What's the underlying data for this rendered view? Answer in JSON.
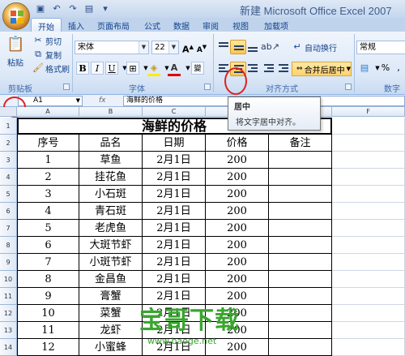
{
  "window": {
    "title": "新建 Microsoft Office Excel 2007"
  },
  "tabs": [
    "开始",
    "插入",
    "页面布局",
    "公式",
    "数据",
    "审阅",
    "视图",
    "加载项"
  ],
  "ribbon": {
    "clipboard": {
      "paste": "粘贴",
      "cut": "剪切",
      "copy": "复制",
      "format_painter": "格式刷",
      "label": "剪贴板"
    },
    "font": {
      "name": "宋体",
      "size": "22",
      "label": "字体",
      "bold": "B",
      "italic": "I",
      "underline": "U"
    },
    "alignment": {
      "wrap_text": "自动换行",
      "merge_center": "合并后居中",
      "label": "对齐方式"
    },
    "number": {
      "format": "常规",
      "percent": "%",
      "label": "数字"
    }
  },
  "formula_bar": {
    "name_box": "A1",
    "fx": "fx",
    "content": "海鲜的价格"
  },
  "tooltip": {
    "title": "居中",
    "body": "将文字居中对齐。"
  },
  "columns": [
    "A",
    "B",
    "C",
    "D",
    "E",
    "F"
  ],
  "sheet": {
    "title": "海鲜的价格",
    "headers": [
      "序号",
      "品名",
      "日期",
      "价格",
      "备注"
    ],
    "rows": [
      [
        "1",
        "草鱼",
        "2月1日",
        "200",
        ""
      ],
      [
        "2",
        "挂花鱼",
        "2月1日",
        "200",
        ""
      ],
      [
        "3",
        "小石斑",
        "2月1日",
        "200",
        ""
      ],
      [
        "4",
        "青石斑",
        "2月1日",
        "200",
        ""
      ],
      [
        "5",
        "老虎鱼",
        "2月1日",
        "200",
        ""
      ],
      [
        "6",
        "大斑节虾",
        "2月1日",
        "200",
        ""
      ],
      [
        "7",
        "小斑节虾",
        "2月1日",
        "200",
        ""
      ],
      [
        "8",
        "金昌鱼",
        "2月1日",
        "200",
        ""
      ],
      [
        "9",
        "膏蟹",
        "2月1日",
        "200",
        ""
      ],
      [
        "10",
        "菜蟹",
        "2月1日",
        "200",
        ""
      ],
      [
        "11",
        "龙虾",
        "2月1日",
        "200",
        ""
      ],
      [
        "12",
        "小蜜蜂",
        "2月1日",
        "200",
        ""
      ]
    ]
  },
  "watermark": {
    "big": "宝哥下载",
    "small": "www.baoge.net"
  }
}
